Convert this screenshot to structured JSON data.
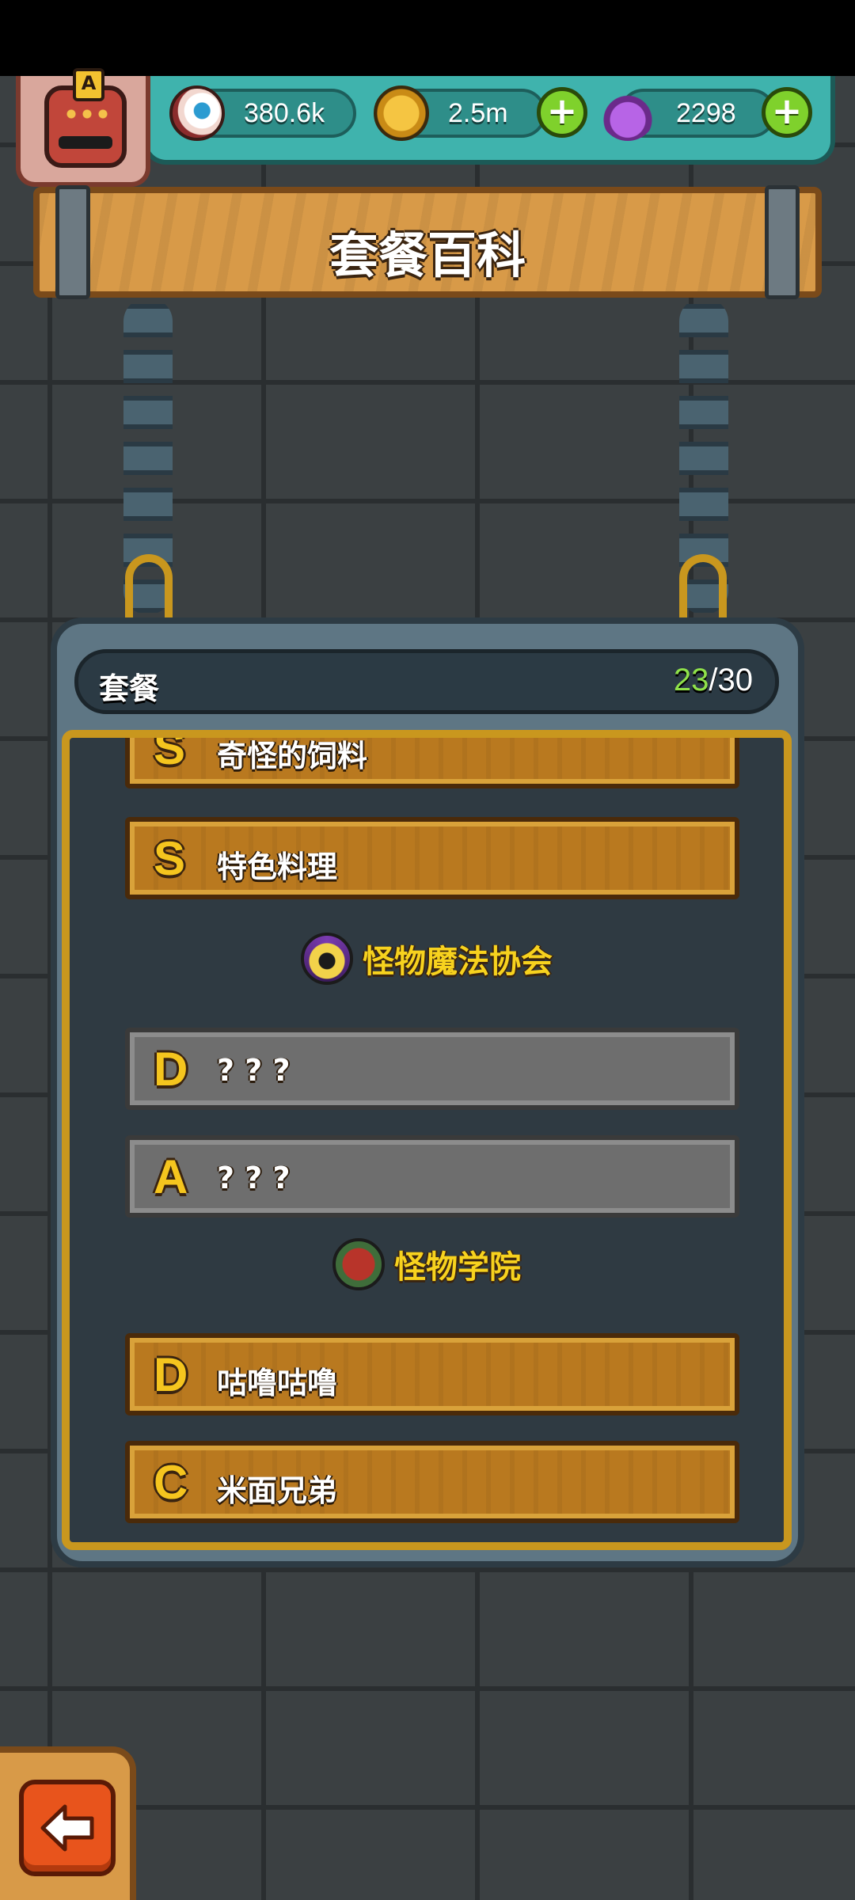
{
  "hud": {
    "eyeballs": "380.6k",
    "coins": "2.5m",
    "potions": "2298",
    "avatar_grade": "A",
    "plus": "+"
  },
  "title": "套餐百科",
  "panel": {
    "label": "套餐",
    "count_current": "23",
    "count_total": "/30"
  },
  "rows": [
    {
      "rank": "S",
      "name": "奇怪的饲料",
      "locked": false
    },
    {
      "rank": "S",
      "name": "特色料理",
      "locked": false
    },
    {
      "rank": "D",
      "name": "? ? ?",
      "locked": true
    },
    {
      "rank": "A",
      "name": "? ? ?",
      "locked": true
    },
    {
      "rank": "D",
      "name": "咕噜咕噜",
      "locked": false
    },
    {
      "rank": "C",
      "name": "米面兄弟",
      "locked": false
    }
  ],
  "sections": [
    {
      "title": "怪物魔法协会",
      "icon": "eye-triangle-icon"
    },
    {
      "title": "怪物学院",
      "icon": "school-building-icon"
    }
  ],
  "icons": {
    "eyeballs": "eyeball-icon",
    "coins": "coin-icon",
    "potions": "potion-icon",
    "back": "back-arrow-icon"
  },
  "colors": {
    "accent_green": "#8fe24a",
    "gold": "#f5c51e",
    "hud_teal": "#3fb3ad"
  }
}
